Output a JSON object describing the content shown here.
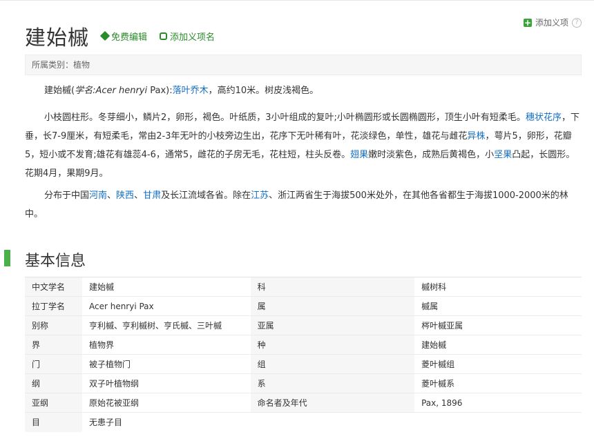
{
  "header": {
    "title": "建始槭",
    "edit_label": "免费编辑",
    "add_item_label": "添加义项名",
    "add_meaning_label": "添加义项",
    "help_glyph": "?"
  },
  "category": "所属类别：植物",
  "summary": {
    "p1": {
      "a": "建始槭(",
      "b": "学名:",
      "c": "Acer henryi",
      "d": " Pax):",
      "link": "落叶乔木",
      "e": "，高约10米。树皮浅褐色。"
    },
    "p2": {
      "a": "小枝圆柱形。冬芽细小，鳞片2，卵形，褐色。叶纸质，3小叶组成的复叶;小叶椭圆形或长圆椭圆形，顶生小叶有短柔毛。",
      "link1": "穗状花序",
      "b": "，下垂，长7-9厘米，有短柔毛，常由2-3年无叶的小枝旁边生出，花序下无叶稀有叶，花淡绿色，单性，雄花与雌花",
      "link2": "异株",
      "c": "，萼片5，卵形，花瓣5，短小或不发育;雄花有雄蕊4-6，通常5，雌花的子房无毛，花柱短，柱头反卷。",
      "link3": "翅果",
      "d": "嫩时淡紫色，成熟后黄褐色，小",
      "link4": "坚果",
      "e": "凸起，长圆形。花期4月，果期9月。"
    },
    "p3": {
      "a": "分布于中国",
      "l1": "河南",
      "s1": "、",
      "l2": "陕西",
      "s2": "、",
      "l3": "甘肃",
      "b": "及长江流域各省。除在",
      "l4": "江苏",
      "c": "、浙江两省生于海拔500米处外，在其他各省都生于海拔1000-2000米的林中。"
    }
  },
  "basic_info": {
    "title": "基本信息",
    "rows": [
      {
        "k1": "中文学名",
        "v1": "建始槭",
        "k2": "科",
        "v2": "槭树科"
      },
      {
        "k1": "拉丁学名",
        "v1": "Acer henryi Pax",
        "k2": "属",
        "v2": "槭属"
      },
      {
        "k1": "别称",
        "v1": "亨利槭、亨利槭树、亨氏槭、三叶槭",
        "k2": "亚属",
        "v2": "梣叶槭亚属"
      },
      {
        "k1": "界",
        "v1": "植物界",
        "k2": "种",
        "v2": "建始槭"
      },
      {
        "k1": "门",
        "v1": "被子植物门",
        "k2": "组",
        "v2": "菱叶槭组"
      },
      {
        "k1": "纲",
        "v1": "双子叶植物纲",
        "k2": "系",
        "v2": "菱叶槭系"
      },
      {
        "k1": "亚纲",
        "v1": "原始花被亚纲",
        "k2": "命名者及年代",
        "v2": "Pax, 1896"
      },
      {
        "k1": "目",
        "v1": "无患子目",
        "k2": "",
        "v2": ""
      }
    ]
  }
}
